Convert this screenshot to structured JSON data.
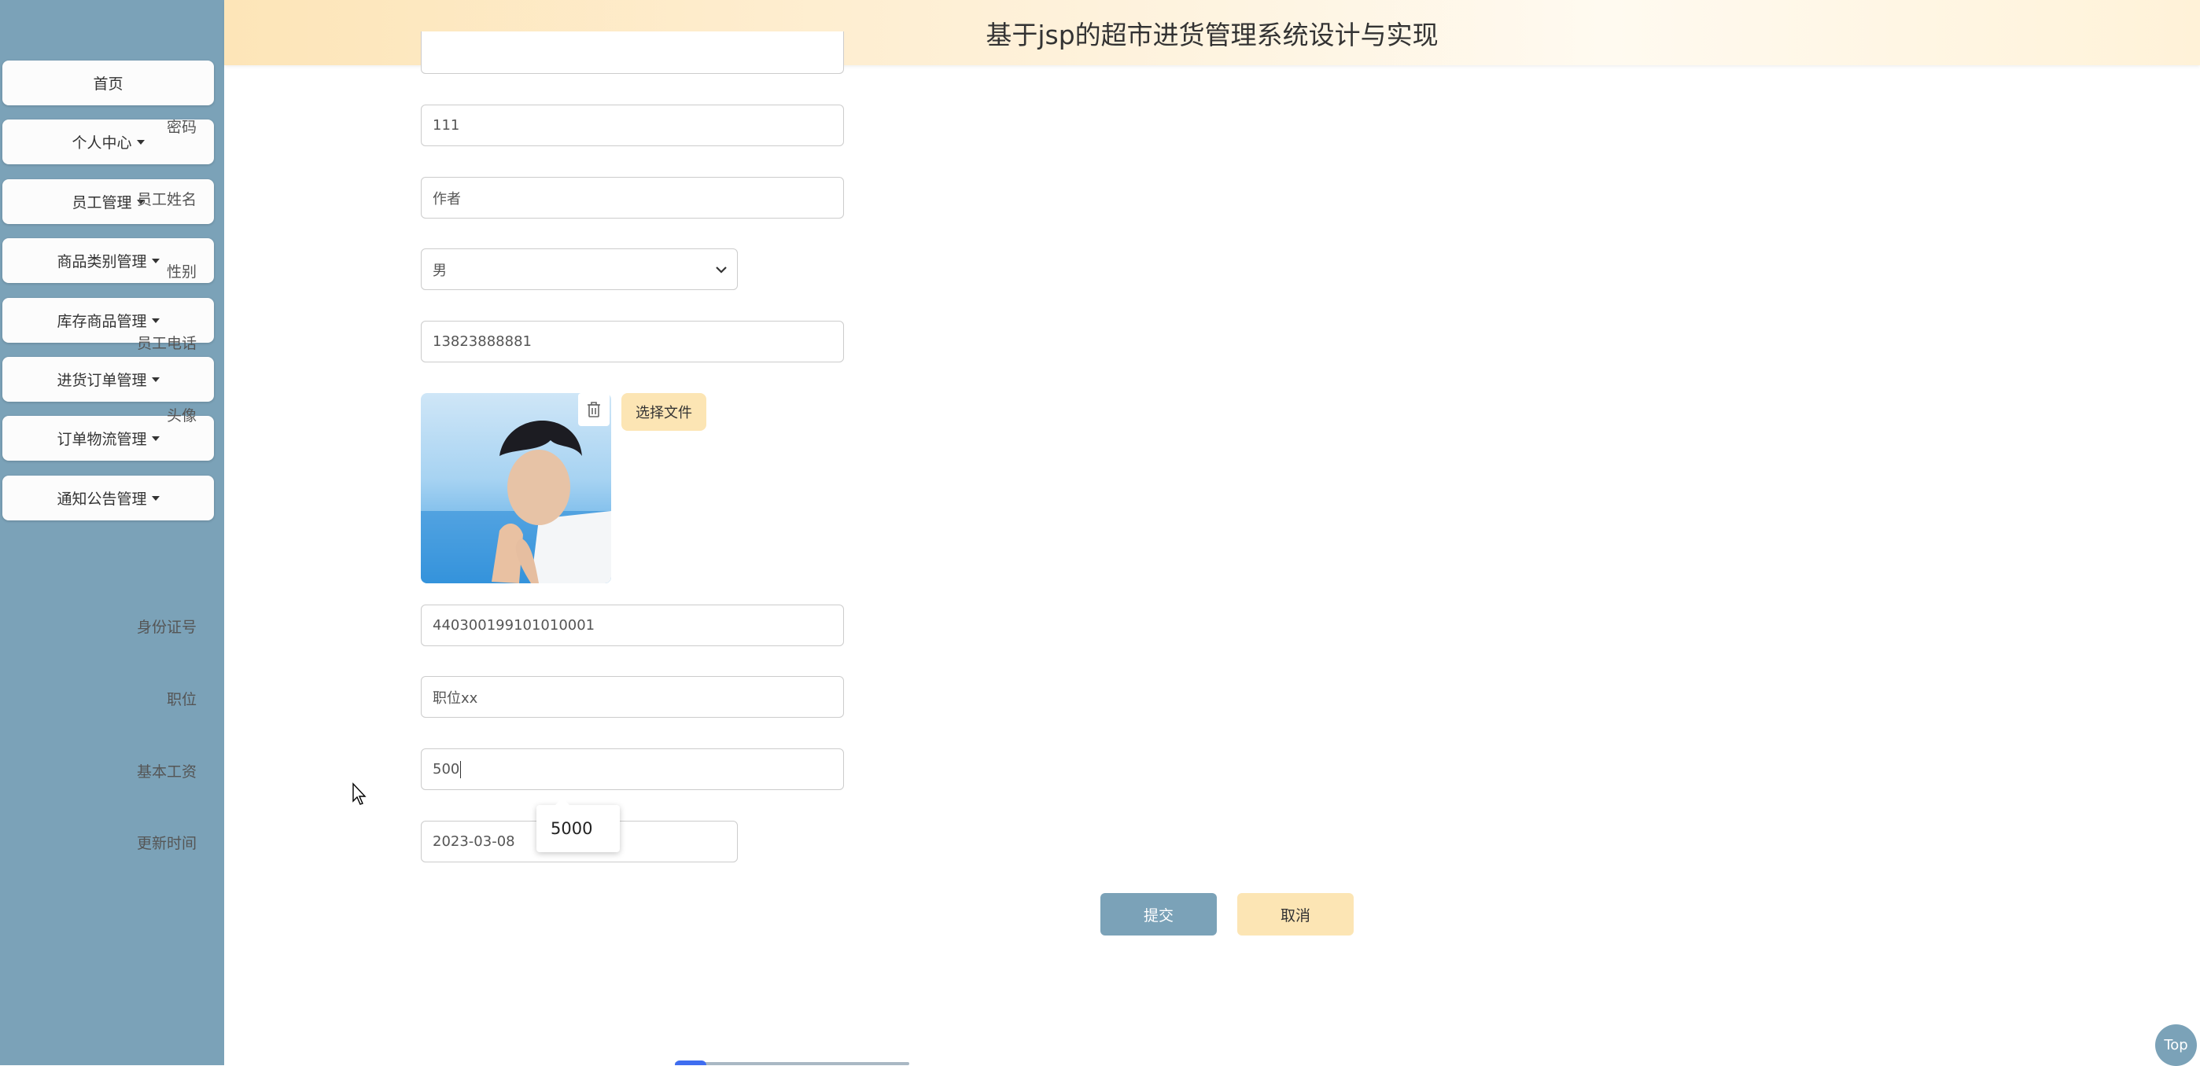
{
  "header": {
    "title": "基于jsp的超市进货管理系统设计与实现"
  },
  "sidebar": {
    "items": [
      {
        "label": "首页",
        "dropdown": false
      },
      {
        "label": "个人中心",
        "dropdown": true
      },
      {
        "label": "员工管理",
        "dropdown": true
      },
      {
        "label": "商品类别管理",
        "dropdown": true
      },
      {
        "label": "库存商品管理",
        "dropdown": true
      },
      {
        "label": "进货订单管理",
        "dropdown": true
      },
      {
        "label": "订单物流管理",
        "dropdown": true
      },
      {
        "label": "通知公告管理",
        "dropdown": true
      }
    ]
  },
  "form": {
    "password": {
      "label": "密码",
      "value": "111"
    },
    "name": {
      "label": "员工姓名",
      "value": "作者"
    },
    "gender": {
      "label": "性别",
      "value": "男"
    },
    "phone": {
      "label": "员工电话",
      "value": "13823888881"
    },
    "avatar": {
      "label": "头像",
      "choose_label": "选择文件"
    },
    "id_card": {
      "label": "身份证号",
      "value": "440300199101010001"
    },
    "position": {
      "label": "职位",
      "value": "职位xx"
    },
    "salary": {
      "label": "基本工资",
      "value": "500"
    },
    "update_time": {
      "label": "更新时间",
      "value": "2023-03-08"
    },
    "autocomplete_suggestion": "5000"
  },
  "actions": {
    "submit_label": "提交",
    "cancel_label": "取消"
  },
  "back_to_top_label": "Top",
  "colors": {
    "sidebar": "#7ba2b8",
    "accent_light": "#fce5b4",
    "header_gradient_start": "#fde5b8"
  },
  "icons": {
    "fullscreen": "fullscreen-icon",
    "user": "user-icon",
    "trash": "trash-icon",
    "caret": "caret-down-icon"
  }
}
